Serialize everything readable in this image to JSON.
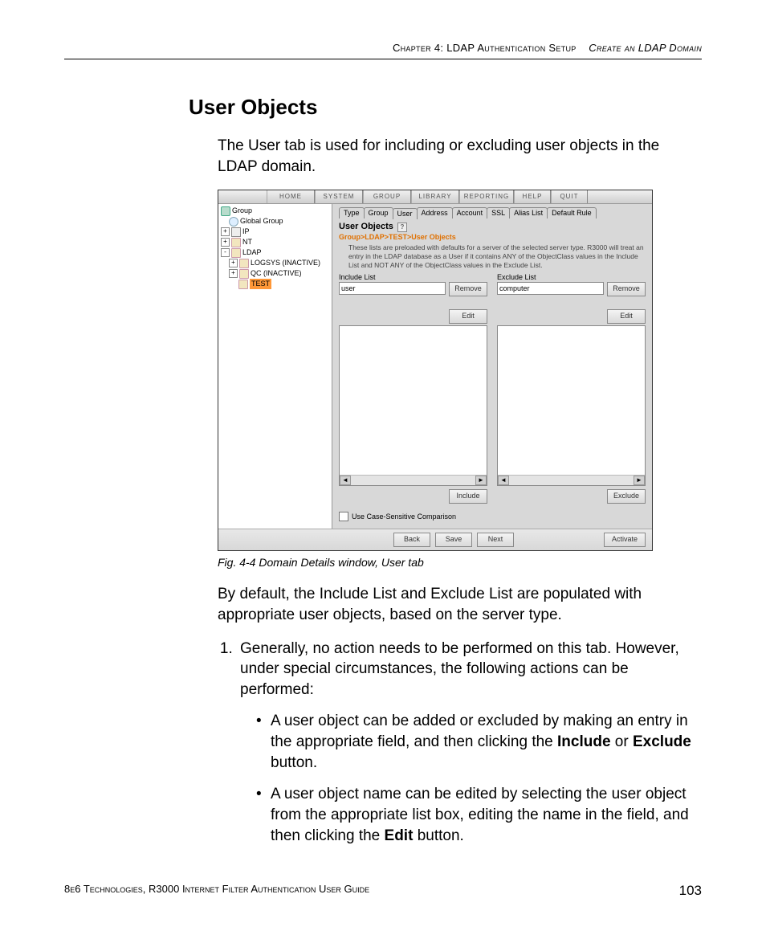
{
  "header": {
    "left": "Chapter 4: LDAP Authentication Setup",
    "right": "Create an LDAP Domain"
  },
  "section_title": "User Objects",
  "intro": "The User tab is used for including or excluding user objects in the LDAP domain.",
  "caption": "Fig. 4-4  Domain Details window, User tab",
  "para_after": "By default, the Include List and Exclude List are populated with appropriate user objects, based on the server type.",
  "step1": "Generally, no action needs to be performed on this tab. However, under special circumstances, the following actions can be performed:",
  "bullet1_a": "A user object can be added or excluded by making an entry in the appropriate field, and then clicking the ",
  "bullet1_b": "Include",
  "bullet1_c": " or ",
  "bullet1_d": "Exclude",
  "bullet1_e": " button.",
  "bullet2_a": "A user object name can be edited by selecting the user object from the appropriate list box, editing the name in the field, and then clicking the ",
  "bullet2_b": "Edit",
  "bullet2_c": " button.",
  "footer": {
    "text": "8e6 Technologies, R3000 Internet Filter Authentication User Guide",
    "page": "103"
  },
  "app": {
    "toolbar": [
      "HOME",
      "SYSTEM",
      "GROUP",
      "LIBRARY",
      "REPORTING",
      "HELP",
      "QUIT"
    ],
    "tree": {
      "root": "Group",
      "global": "Global Group",
      "ip": "IP",
      "nt": "NT",
      "ldap": "LDAP",
      "logsys": "LOGSYS (INACTIVE)",
      "qc": "QC (INACTIVE)",
      "test": "TEST"
    },
    "panel": {
      "tabs": [
        "Type",
        "Group",
        "User",
        "Address",
        "Account",
        "SSL",
        "Alias List",
        "Default Rule"
      ],
      "active_tab_index": 2,
      "title": "User Objects",
      "help": "?",
      "breadcrumb": "Group>LDAP>TEST>User Objects",
      "desc": "These lists are preloaded with defaults for a server of the selected server type.  R3000 will treat an entry in the LDAP database as a User if it contains ANY of the ObjectClass values in the Include List and NOT ANY of the ObjectClass values in the Exclude List.",
      "include_label": "Include List",
      "exclude_label": "Exclude List",
      "include_value": "user",
      "exclude_value": "computer",
      "btn_remove": "Remove",
      "btn_edit": "Edit",
      "btn_include": "Include",
      "btn_exclude": "Exclude",
      "checkbox_label": "Use Case-Sensitive Comparison",
      "btn_back": "Back",
      "btn_save": "Save",
      "btn_next": "Next",
      "btn_activate": "Activate"
    }
  }
}
